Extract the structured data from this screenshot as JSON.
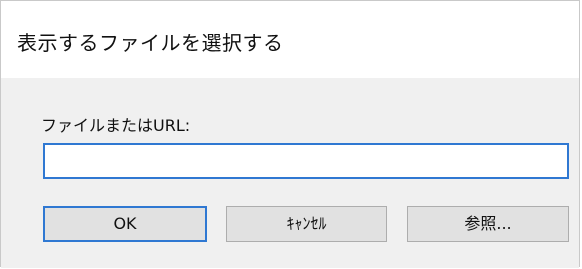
{
  "dialog": {
    "title": "表示するファイルを選択する"
  },
  "form": {
    "label": "ファイルまたはURL:",
    "input_value": "",
    "input_placeholder": ""
  },
  "buttons": {
    "ok": "OK",
    "cancel": "ｷｬﾝｾﾙ",
    "browse": "参照..."
  },
  "colors": {
    "accent": "#2f78d2",
    "dialog_bg": "#f0f0f0",
    "title_bg": "#ffffff",
    "button_bg": "#e1e1e1"
  }
}
